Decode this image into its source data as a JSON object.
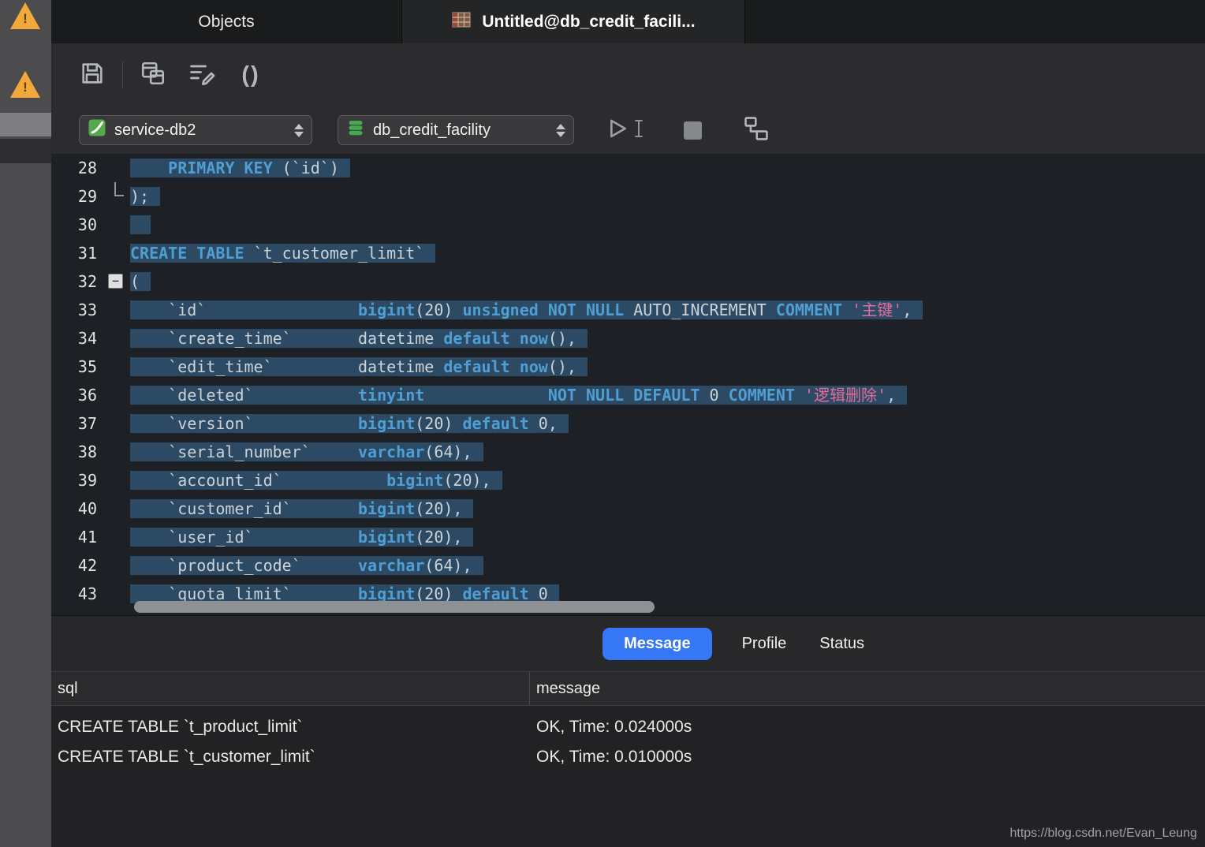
{
  "tabs": [
    {
      "label": "Objects"
    },
    {
      "label": "Untitled@db_credit_facili..."
    }
  ],
  "toolbar": {
    "icons": [
      "save-icon",
      "open-tables-icon",
      "beautify-sql-icon",
      "parentheses-icon"
    ],
    "parentheses_glyph": "()"
  },
  "connection_bar": {
    "connection": {
      "value": "service-db2",
      "icon": "connection-icon"
    },
    "database": {
      "value": "db_credit_facility",
      "icon": "database-icon"
    },
    "buttons": [
      "run",
      "stop",
      "explain"
    ]
  },
  "editor": {
    "selection_color": "#2c4a63",
    "lines": [
      {
        "num": "28",
        "fold": "",
        "tokens": [
          [
            "p",
            "    "
          ],
          [
            "k",
            "PRIMARY KEY"
          ],
          [
            "p",
            " (`id`)"
          ]
        ]
      },
      {
        "num": "29",
        "fold": "end",
        "tokens": [
          [
            "p",
            ");"
          ]
        ]
      },
      {
        "num": "30",
        "fold": "",
        "tokens": []
      },
      {
        "num": "31",
        "fold": "",
        "tokens": [
          [
            "k",
            "CREATE TABLE"
          ],
          [
            "p",
            " `t_customer_limit`"
          ]
        ]
      },
      {
        "num": "32",
        "fold": "collapse",
        "tokens": [
          [
            "p",
            "("
          ]
        ]
      },
      {
        "num": "33",
        "fold": "",
        "tokens": [
          [
            "p",
            "    `id`                "
          ],
          [
            "k",
            "bigint"
          ],
          [
            "p",
            "(20) "
          ],
          [
            "k",
            "unsigned"
          ],
          [
            "p",
            " "
          ],
          [
            "k",
            "NOT NULL"
          ],
          [
            "p",
            " AUTO_INCREMENT "
          ],
          [
            "k",
            "COMMENT"
          ],
          [
            "p",
            " "
          ],
          [
            "s",
            "'主键'"
          ],
          [
            "p",
            ","
          ]
        ]
      },
      {
        "num": "34",
        "fold": "",
        "tokens": [
          [
            "p",
            "    `create_time`       datetime "
          ],
          [
            "k",
            "default"
          ],
          [
            "p",
            " "
          ],
          [
            "k",
            "now"
          ],
          [
            "p",
            "(),"
          ]
        ]
      },
      {
        "num": "35",
        "fold": "",
        "tokens": [
          [
            "p",
            "    `edit_time`         datetime "
          ],
          [
            "k",
            "default"
          ],
          [
            "p",
            " "
          ],
          [
            "k",
            "now"
          ],
          [
            "p",
            "(),"
          ]
        ]
      },
      {
        "num": "36",
        "fold": "",
        "tokens": [
          [
            "p",
            "    `deleted`           "
          ],
          [
            "k",
            "tinyint"
          ],
          [
            "p",
            "             "
          ],
          [
            "k",
            "NOT NULL"
          ],
          [
            "p",
            " "
          ],
          [
            "k",
            "DEFAULT"
          ],
          [
            "p",
            " 0 "
          ],
          [
            "k",
            "COMMENT"
          ],
          [
            "p",
            " "
          ],
          [
            "s",
            "'逻辑删除'"
          ],
          [
            "p",
            ","
          ]
        ]
      },
      {
        "num": "37",
        "fold": "",
        "tokens": [
          [
            "p",
            "    `version`           "
          ],
          [
            "k",
            "bigint"
          ],
          [
            "p",
            "(20) "
          ],
          [
            "k",
            "default"
          ],
          [
            "p",
            " 0,"
          ]
        ]
      },
      {
        "num": "38",
        "fold": "",
        "tokens": [
          [
            "p",
            "    `serial_number`     "
          ],
          [
            "k",
            "varchar"
          ],
          [
            "p",
            "(64),"
          ]
        ]
      },
      {
        "num": "39",
        "fold": "",
        "tokens": [
          [
            "p",
            "    `account_id`           "
          ],
          [
            "k",
            "bigint"
          ],
          [
            "p",
            "(20),"
          ]
        ]
      },
      {
        "num": "40",
        "fold": "",
        "tokens": [
          [
            "p",
            "    `customer_id`       "
          ],
          [
            "k",
            "bigint"
          ],
          [
            "p",
            "(20),"
          ]
        ]
      },
      {
        "num": "41",
        "fold": "",
        "tokens": [
          [
            "p",
            "    `user_id`           "
          ],
          [
            "k",
            "bigint"
          ],
          [
            "p",
            "(20),"
          ]
        ]
      },
      {
        "num": "42",
        "fold": "",
        "tokens": [
          [
            "p",
            "    `product_code`      "
          ],
          [
            "k",
            "varchar"
          ],
          [
            "p",
            "(64),"
          ]
        ]
      },
      {
        "num": "43",
        "fold": "",
        "tokens": [
          [
            "p",
            "    `quota_limit`       "
          ],
          [
            "k",
            "bigint"
          ],
          [
            "p",
            "(20) "
          ],
          [
            "k",
            "default"
          ],
          [
            "p",
            " 0"
          ]
        ]
      }
    ]
  },
  "results_panel": {
    "tabs": [
      {
        "label": "Message",
        "active": true
      },
      {
        "label": "Profile",
        "active": false
      },
      {
        "label": "Status",
        "active": false
      }
    ],
    "columns": [
      "sql",
      "message"
    ],
    "rows": [
      {
        "sql": "CREATE TABLE `t_product_limit`",
        "message": "OK, Time: 0.024000s"
      },
      {
        "sql": "CREATE TABLE `t_customer_limit`",
        "message": "OK, Time: 0.010000s"
      }
    ]
  },
  "watermark": "https://blog.csdn.net/Evan_Leung"
}
